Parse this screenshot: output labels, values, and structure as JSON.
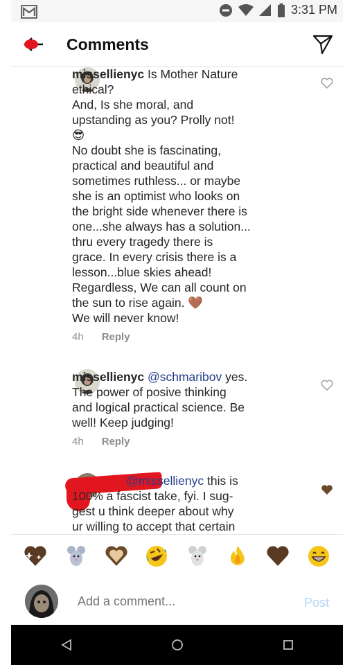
{
  "status_bar": {
    "time": "3:31 PM"
  },
  "header": {
    "title": "Comments"
  },
  "comments": [
    {
      "username": "missellienyc",
      "lines": [
        "Is Mother Nature",
        "ethical?",
        "And, Is she moral, and",
        "upstanding as you? Prolly not!",
        "😎",
        "No doubt she is fascinating,",
        "practical and beautiful and",
        "sometimes ruthless... or maybe",
        "she  is an optimist who looks on",
        "the bright side whenever there is",
        "one...she always has a solution...",
        "thru every tragedy there is",
        "grace. In every crisis there is a",
        "lesson...blue skies ahead!",
        "Regardless, We can all count on",
        "the sun to rise again. 🤎",
        "We will never know!"
      ],
      "time": "4h",
      "reply": "Reply"
    },
    {
      "username": "missellienyc",
      "mention": "@schmaribov",
      "lines": [
        "yes.",
        "The power of posive thinking",
        "and  logical practical science. Be",
        "well! Keep judging!"
      ],
      "time": "4h",
      "reply": "Reply"
    },
    {
      "mention": "@missellienyc",
      "lines": [
        "this is",
        "100% a fascist take, fyi. I sug-",
        "gest u think deeper about why",
        "ur willing to accept that certain"
      ]
    }
  ],
  "emoji_bar": [
    "💖",
    "🐭",
    "🤎",
    "🤣",
    "🐭",
    "🔥",
    "🤎",
    "😁"
  ],
  "compose": {
    "placeholder": "Add a comment...",
    "post": "Post"
  },
  "colors": {
    "mention": "#233e8b",
    "redaction": "#e2161f",
    "post_disabled": "#b3d4f5"
  }
}
